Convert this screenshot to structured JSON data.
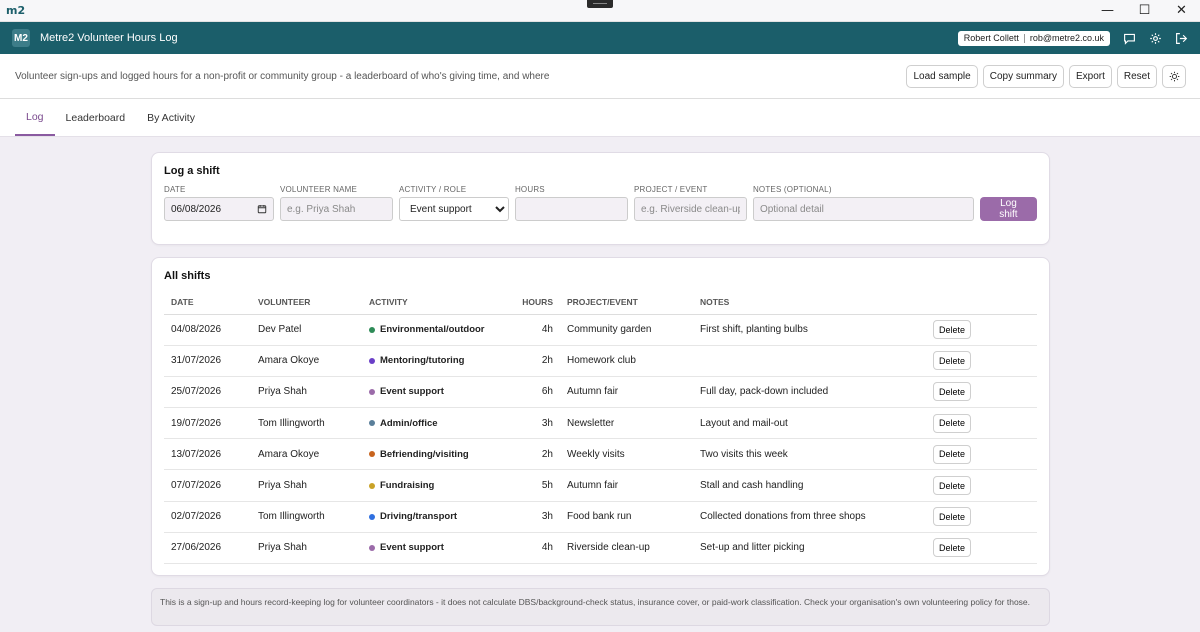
{
  "os": {
    "logo": "m2",
    "controls": [
      "—",
      "☐",
      "✕"
    ]
  },
  "header": {
    "badge": "M2",
    "title": "Metre2 Volunteer Hours Log",
    "user_name": "Robert Collett",
    "user_email": "rob@metre2.co.uk",
    "icons": [
      "chat-icon",
      "gear-icon",
      "logout-icon"
    ],
    "accent": "#1b5e6a"
  },
  "subheader": {
    "description": "Volunteer sign-ups and logged hours for a non-profit or community group - a leaderboard of who's giving time, and where",
    "actions": {
      "load_sample": "Load sample",
      "copy_summary": "Copy summary",
      "export": "Export",
      "reset": "Reset"
    }
  },
  "tabs": [
    {
      "label": "Log",
      "active": true
    },
    {
      "label": "Leaderboard",
      "active": false
    },
    {
      "label": "By Activity",
      "active": false
    }
  ],
  "form": {
    "title": "Log a shift",
    "date_label": "DATE",
    "date_value": "06/08/2026",
    "volunteer_label": "VOLUNTEER NAME",
    "volunteer_placeholder": "e.g. Priya Shah",
    "activity_label": "ACTIVITY / ROLE",
    "activity_value": "Event support",
    "hours_label": "HOURS",
    "hours_placeholder": "",
    "project_label": "PROJECT / EVENT",
    "project_placeholder": "e.g. Riverside clean-up",
    "notes_label": "NOTES (OPTIONAL)",
    "notes_placeholder": "Optional detail",
    "submit": "Log shift",
    "submit_color": "#9b6ba9"
  },
  "shifts": {
    "title": "All shifts",
    "columns": {
      "date": "DATE",
      "volunteer": "VOLUNTEER",
      "activity": "ACTIVITY",
      "hours": "HOURS",
      "project": "PROJECT/EVENT",
      "notes": "NOTES"
    },
    "delete_label": "Delete",
    "rows": [
      {
        "date": "04/08/2026",
        "volunteer": "Dev Patel",
        "activity": "Environmental/outdoor",
        "color": "#2e8b57",
        "hours": "4h",
        "project": "Community garden",
        "notes": "First shift, planting bulbs"
      },
      {
        "date": "31/07/2026",
        "volunteer": "Amara Okoye",
        "activity": "Mentoring/tutoring",
        "color": "#6a3fc7",
        "hours": "2h",
        "project": "Homework club",
        "notes": ""
      },
      {
        "date": "25/07/2026",
        "volunteer": "Priya Shah",
        "activity": "Event support",
        "color": "#9b6ba9",
        "hours": "6h",
        "project": "Autumn fair",
        "notes": "Full day, pack-down included"
      },
      {
        "date": "19/07/2026",
        "volunteer": "Tom Illingworth",
        "activity": "Admin/office",
        "color": "#5a7f9a",
        "hours": "3h",
        "project": "Newsletter",
        "notes": "Layout and mail-out"
      },
      {
        "date": "13/07/2026",
        "volunteer": "Amara Okoye",
        "activity": "Befriending/visiting",
        "color": "#c8641e",
        "hours": "2h",
        "project": "Weekly visits",
        "notes": "Two visits this week"
      },
      {
        "date": "07/07/2026",
        "volunteer": "Priya Shah",
        "activity": "Fundraising",
        "color": "#c9a227",
        "hours": "5h",
        "project": "Autumn fair",
        "notes": "Stall and cash handling"
      },
      {
        "date": "02/07/2026",
        "volunteer": "Tom Illingworth",
        "activity": "Driving/transport",
        "color": "#2f6fe0",
        "hours": "3h",
        "project": "Food bank run",
        "notes": "Collected donations from three shops"
      },
      {
        "date": "27/06/2026",
        "volunteer": "Priya Shah",
        "activity": "Event support",
        "color": "#9b6ba9",
        "hours": "4h",
        "project": "Riverside clean-up",
        "notes": "Set-up and litter picking"
      }
    ]
  },
  "disclaimer": "This is a sign-up and hours record-keeping log for volunteer coordinators - it does not calculate DBS/background-check status, insurance cover, or paid-work classification. Check your organisation's own volunteering policy for those."
}
